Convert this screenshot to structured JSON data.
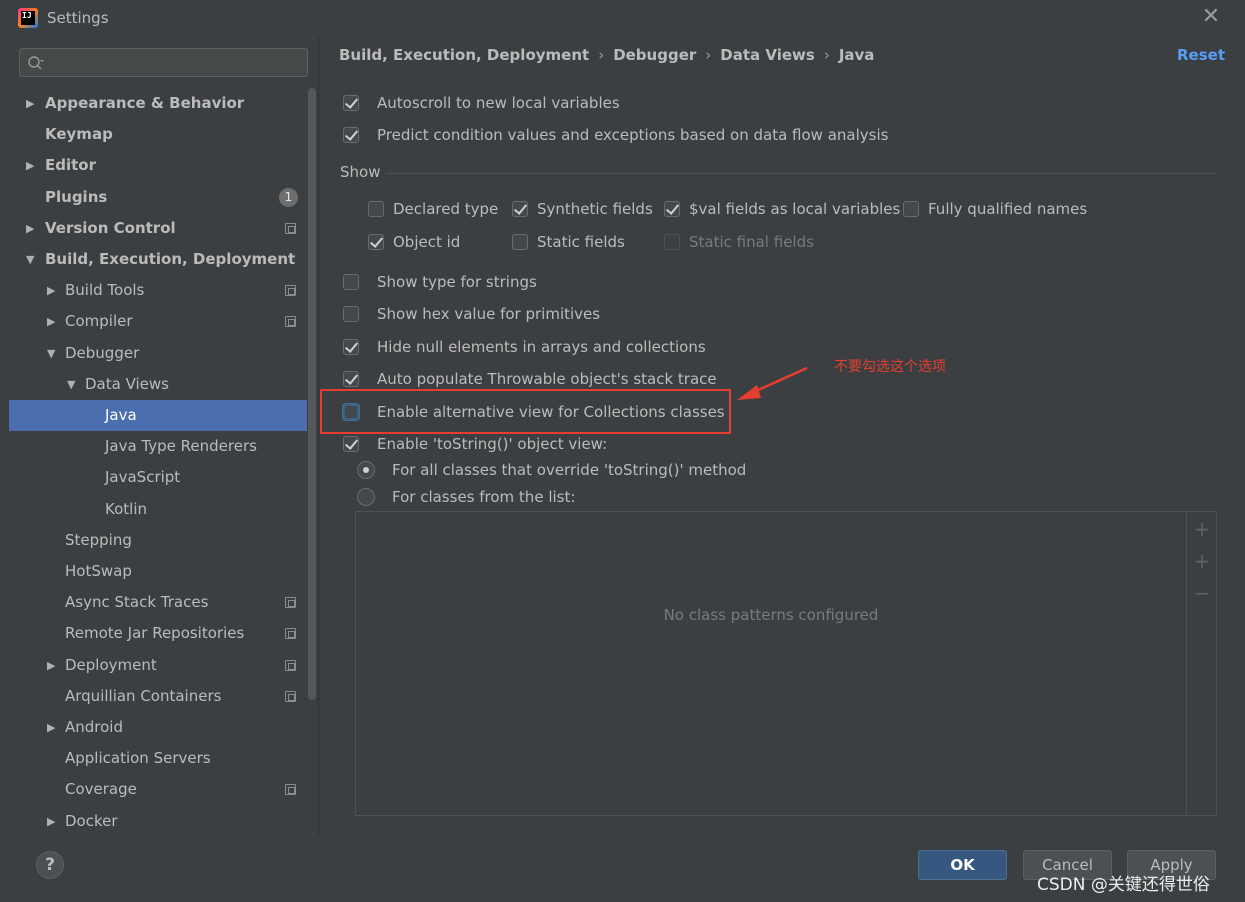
{
  "window": {
    "title": "Settings",
    "close_label": "✕"
  },
  "search": {
    "placeholder": ""
  },
  "tree": [
    {
      "label": "Appearance & Behavior",
      "arrow": "▶",
      "bold": true
    },
    {
      "label": "Keymap",
      "arrow": "",
      "bold": true
    },
    {
      "label": "Editor",
      "arrow": "▶",
      "bold": true
    },
    {
      "label": "Plugins",
      "arrow": "",
      "bold": true,
      "badge": "1"
    },
    {
      "label": "Version Control",
      "arrow": "▶",
      "bold": true
    },
    {
      "label": "Build, Execution, Deployment",
      "arrow": "▼",
      "bold": true
    },
    {
      "label": "Build Tools",
      "arrow": "▶"
    },
    {
      "label": "Compiler",
      "arrow": "▶"
    },
    {
      "label": "Debugger",
      "arrow": "▼"
    },
    {
      "label": "Data Views",
      "arrow": "▼"
    },
    {
      "label": "Java",
      "arrow": "",
      "selected": true
    },
    {
      "label": "Java Type Renderers",
      "arrow": ""
    },
    {
      "label": "JavaScript",
      "arrow": ""
    },
    {
      "label": "Kotlin",
      "arrow": ""
    },
    {
      "label": "Stepping",
      "arrow": ""
    },
    {
      "label": "HotSwap",
      "arrow": ""
    },
    {
      "label": "Async Stack Traces",
      "arrow": ""
    },
    {
      "label": "Remote Jar Repositories",
      "arrow": ""
    },
    {
      "label": "Deployment",
      "arrow": "▶"
    },
    {
      "label": "Arquillian Containers",
      "arrow": ""
    },
    {
      "label": "Android",
      "arrow": "▶"
    },
    {
      "label": "Application Servers",
      "arrow": ""
    },
    {
      "label": "Coverage",
      "arrow": ""
    },
    {
      "label": "Docker",
      "arrow": "▶"
    }
  ],
  "breadcrumb": [
    "Build, Execution, Deployment",
    "Debugger",
    "Data Views",
    "Java"
  ],
  "breadcrumb_sep": "›",
  "reset_label": "Reset",
  "options": {
    "autoscroll": {
      "label": "Autoscroll to new local variables",
      "checked": true
    },
    "predict": {
      "label": "Predict condition values and exceptions based on data flow analysis",
      "checked": true
    },
    "show_label": "Show",
    "declared_type": {
      "label": "Declared type",
      "checked": false
    },
    "synthetic_fields": {
      "label": "Synthetic fields",
      "checked": true
    },
    "val_fields": {
      "label": "$val fields as local variables",
      "checked": true
    },
    "fully_qualified": {
      "label": "Fully qualified names",
      "checked": false
    },
    "object_id": {
      "label": "Object id",
      "checked": true
    },
    "static_fields": {
      "label": "Static fields",
      "checked": false
    },
    "static_final": {
      "label": "Static final fields",
      "checked": false,
      "disabled": true
    },
    "type_strings": {
      "label": "Show type for strings",
      "checked": false
    },
    "hex_primitives": {
      "label": "Show hex value for primitives",
      "checked": false
    },
    "hide_null": {
      "label": "Hide null elements in arrays and collections",
      "checked": true
    },
    "auto_populate": {
      "label": "Auto populate Throwable object's stack trace",
      "checked": true
    },
    "alt_view": {
      "label": "Enable alternative view for Collections classes",
      "checked": false
    },
    "tostring": {
      "label": "Enable 'toString()' object view:",
      "checked": true
    },
    "all_classes": {
      "label": "For all classes that override 'toString()' method",
      "selected": true
    },
    "from_list": {
      "label": "For classes from the list:",
      "selected": false
    }
  },
  "patterns": {
    "empty_text": "No class patterns configured",
    "add_icon": "+",
    "add_pattern_icon": "+",
    "remove_icon": "−"
  },
  "annotation": {
    "text": "不要勾选这个选项",
    "color": "#e53d30"
  },
  "buttons": {
    "help": "?",
    "ok": "OK",
    "cancel": "Cancel",
    "apply": "Apply"
  },
  "watermark": "CSDN @关键还得世俗",
  "colors": {
    "selection": "#4b6eaf",
    "link": "#589df6",
    "primary_button": "#365880"
  }
}
